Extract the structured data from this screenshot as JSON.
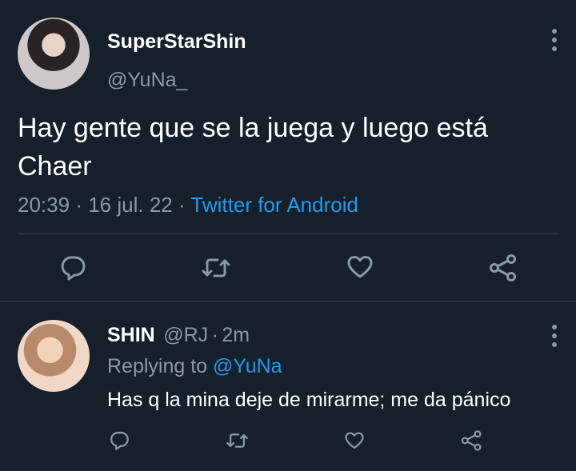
{
  "main_tweet": {
    "display_name": "SuperStarShin",
    "handle": "@YuNa_",
    "text_line1": "Hay gente que se la juega y luego está",
    "text_line2": "Chaer",
    "time": "20:39",
    "date": "16 jul. 22",
    "source": "Twitter for Android",
    "separator": "·"
  },
  "reply_tweet": {
    "display_name": "SHIN",
    "handle": "@RJ",
    "age": "2m",
    "separator": "·",
    "replying_prefix": "Replying to",
    "replying_mention": "@YuNa",
    "text": "Has q la mina deje de mirarme; me da pánico"
  },
  "icons": [
    "reply-icon",
    "retweet-icon",
    "like-icon",
    "share-icon",
    "more-options-icon"
  ],
  "colors": {
    "background": "#15202b",
    "link": "#1d9bf0",
    "muted": "#8899a6",
    "divider": "#38444d"
  }
}
